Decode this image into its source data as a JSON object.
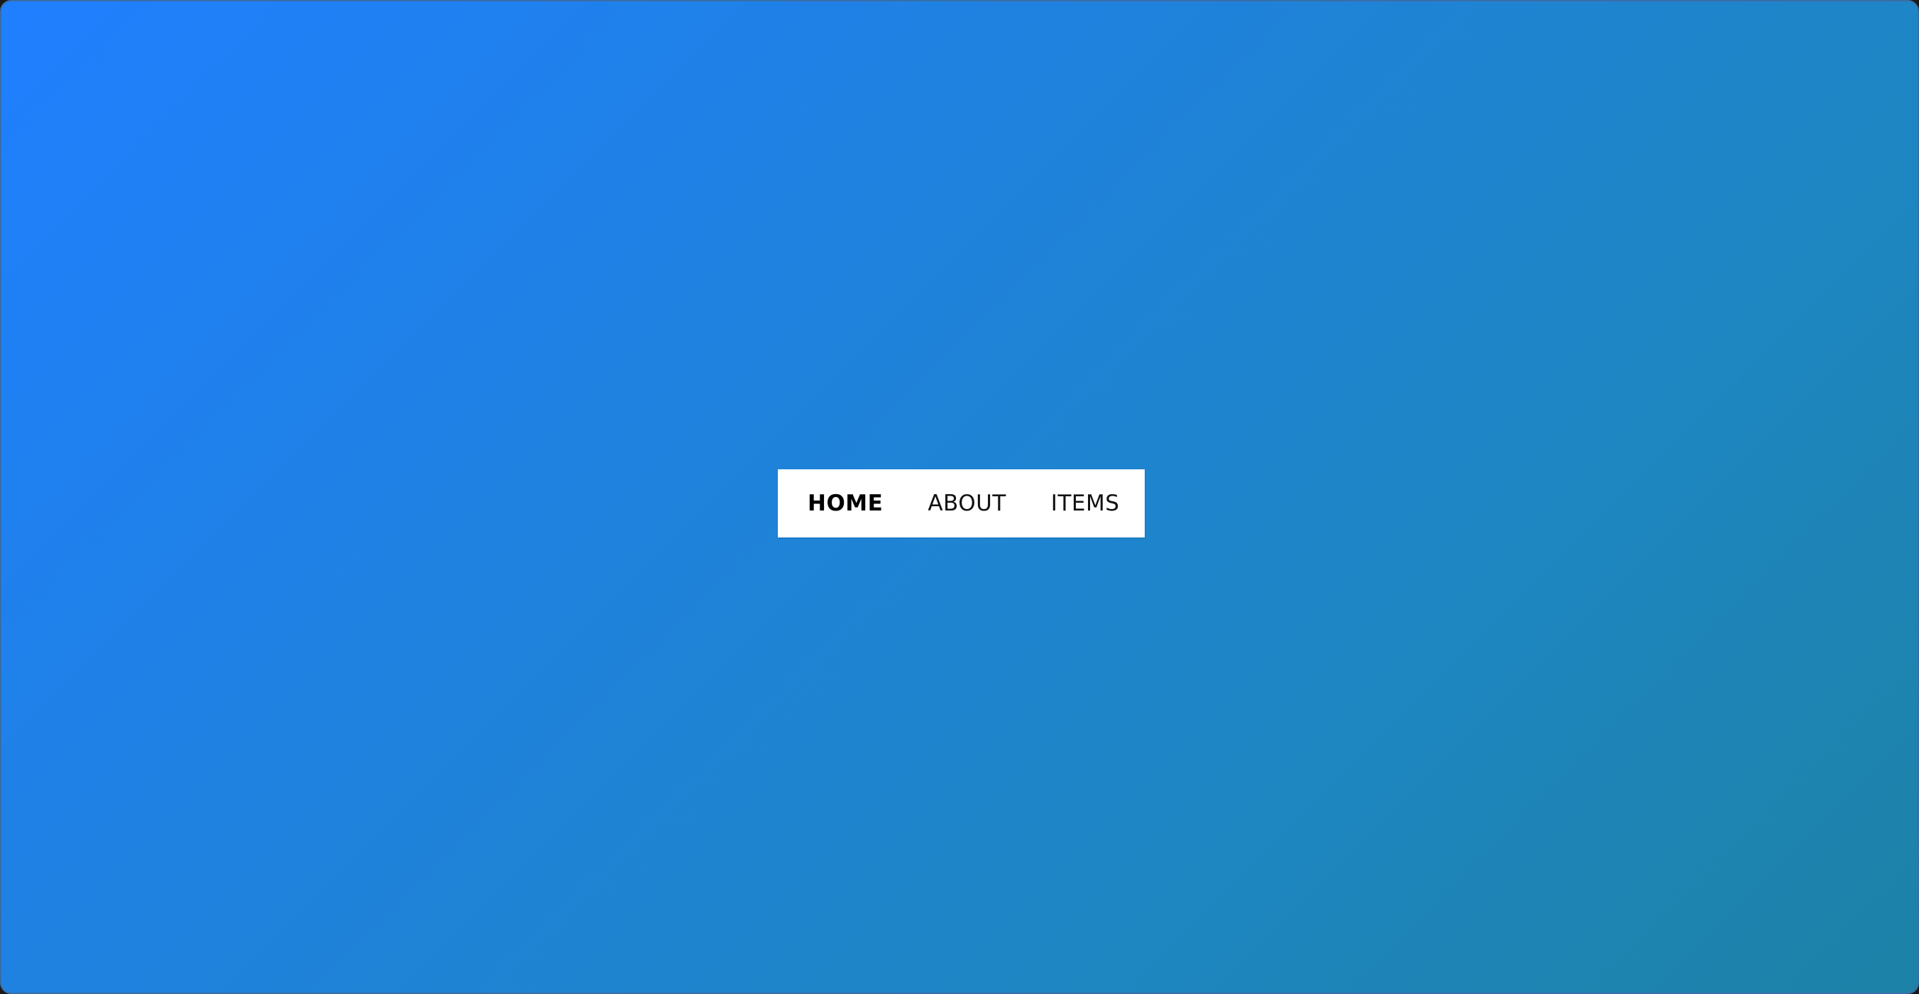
{
  "colors": {
    "gradient_start": "#1f7fff",
    "gradient_end": "#1d82a6",
    "nav_background": "#ffffff",
    "nav_text": "#111111"
  },
  "nav": {
    "items": [
      {
        "label": "HOME",
        "active": true
      },
      {
        "label": "ABOUT",
        "active": false
      },
      {
        "label": "ITEMS",
        "active": false
      }
    ]
  }
}
